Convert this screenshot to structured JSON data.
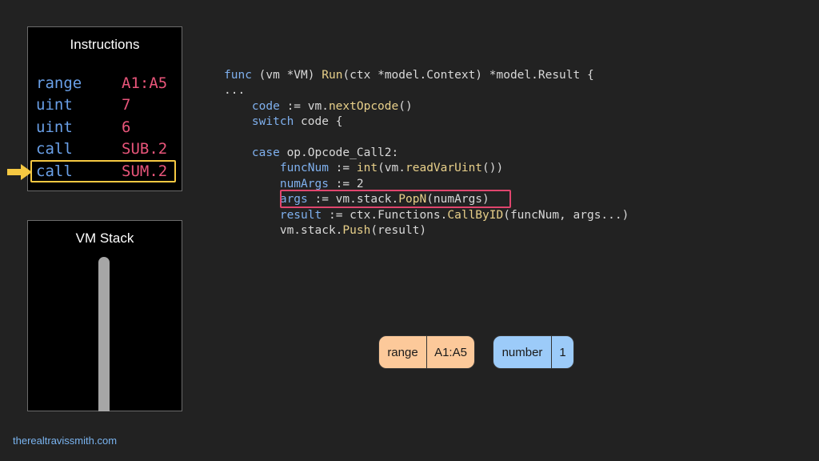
{
  "instructions_panel": {
    "title": "Instructions",
    "rows": [
      {
        "op": "range",
        "arg": "A1:A5"
      },
      {
        "op": "uint",
        "arg": "7"
      },
      {
        "op": "uint",
        "arg": "6"
      },
      {
        "op": "call",
        "arg": "SUB.2"
      },
      {
        "op": "call",
        "arg": "SUM.2"
      }
    ],
    "current_index": 4,
    "pointer_color": "#f5c842"
  },
  "stack_panel": {
    "title": "VM Stack"
  },
  "code_lines": [
    [
      {
        "t": "func",
        "c": "kw"
      },
      {
        "t": " (vm *VM) ",
        "c": "pl"
      },
      {
        "t": "Run",
        "c": "fn"
      },
      {
        "t": "(ctx *model.Context) *model.Result {",
        "c": "pl"
      }
    ],
    [
      {
        "t": "...",
        "c": "pl"
      }
    ],
    [
      {
        "t": "    ",
        "c": "pl"
      },
      {
        "t": "code",
        "c": "kw"
      },
      {
        "t": " := vm.",
        "c": "pl"
      },
      {
        "t": "nextOpcode",
        "c": "fn"
      },
      {
        "t": "()",
        "c": "pl"
      }
    ],
    [
      {
        "t": "    ",
        "c": "pl"
      },
      {
        "t": "switch",
        "c": "kw"
      },
      {
        "t": " code {",
        "c": "pl"
      }
    ],
    [
      {
        "t": "",
        "c": "pl"
      }
    ],
    [
      {
        "t": "    ",
        "c": "pl"
      },
      {
        "t": "case",
        "c": "kw"
      },
      {
        "t": " op.Opcode_Call2:",
        "c": "pl"
      }
    ],
    [
      {
        "t": "        ",
        "c": "pl"
      },
      {
        "t": "funcNum",
        "c": "kw"
      },
      {
        "t": " := ",
        "c": "pl"
      },
      {
        "t": "int",
        "c": "fn"
      },
      {
        "t": "(vm.",
        "c": "pl"
      },
      {
        "t": "readVarUint",
        "c": "fn"
      },
      {
        "t": "())",
        "c": "pl"
      }
    ],
    [
      {
        "t": "        ",
        "c": "pl"
      },
      {
        "t": "numArgs",
        "c": "kw"
      },
      {
        "t": " := 2",
        "c": "pl"
      }
    ],
    [
      {
        "t": "        ",
        "c": "pl"
      },
      {
        "t": "args",
        "c": "kw"
      },
      {
        "t": " := vm.stack.",
        "c": "pl"
      },
      {
        "t": "PopN",
        "c": "fn"
      },
      {
        "t": "(numArgs)",
        "c": "pl"
      }
    ],
    [
      {
        "t": "        ",
        "c": "pl"
      },
      {
        "t": "result",
        "c": "kw"
      },
      {
        "t": " := ctx.Functions.",
        "c": "pl"
      },
      {
        "t": "CallByID",
        "c": "fn"
      },
      {
        "t": "(funcNum, args...)",
        "c": "pl"
      }
    ],
    [
      {
        "t": "        vm.stack.",
        "c": "pl"
      },
      {
        "t": "Push",
        "c": "fn"
      },
      {
        "t": "(result)",
        "c": "pl"
      }
    ]
  ],
  "highlighted_line": 8,
  "highlight_color": "#e0456d",
  "values": [
    {
      "type": "range",
      "value": "A1:A5",
      "color": "#fcc99a"
    },
    {
      "type": "number",
      "value": "1",
      "color": "#9ccbf9"
    }
  ],
  "footer": "therealtravissmith.com"
}
